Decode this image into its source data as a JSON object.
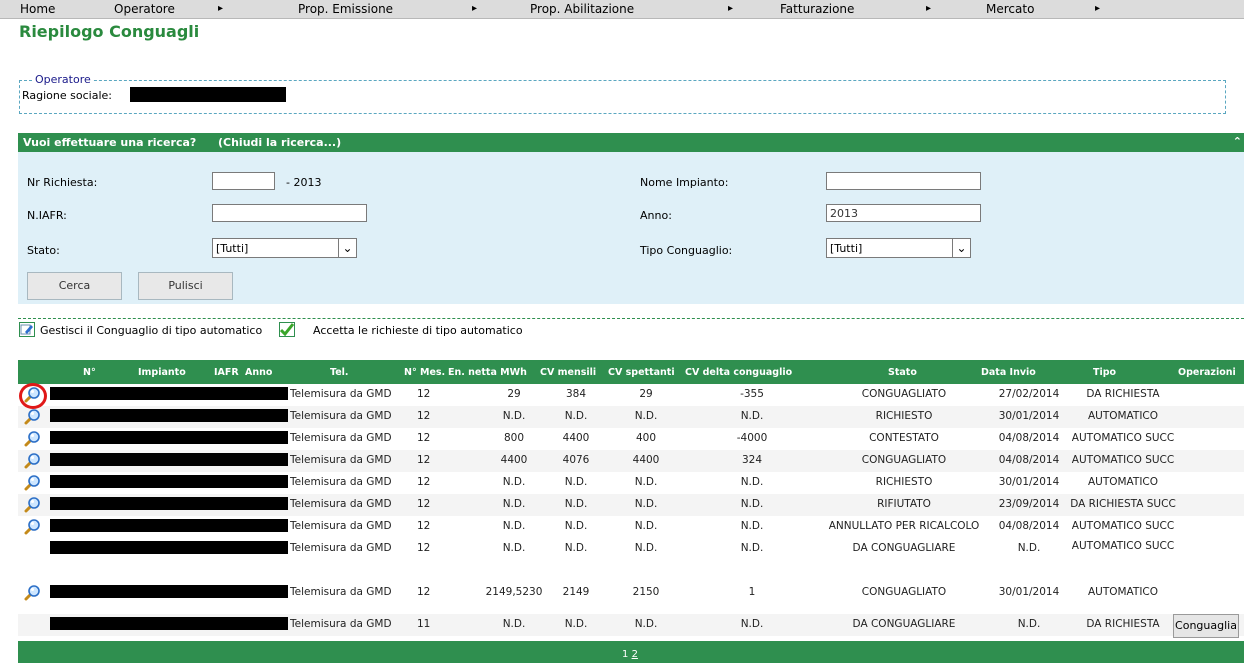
{
  "menu": {
    "items": [
      "Home",
      "Operatore",
      "Prop. Emissione",
      "Prop. Abilitazione",
      "Fatturazione",
      "Mercato"
    ],
    "arrow": "▸"
  },
  "page": {
    "title": "Riepilogo Conguagli"
  },
  "operatore": {
    "legend": "Operatore",
    "ragione_label": "Ragione sociale:"
  },
  "search": {
    "question": "Vuoi effettuare una ricerca?",
    "close_link": "(Chiudi la ricerca...)",
    "collapse_icon": "double-chevron-up-icon",
    "nr_richiesta_label": "Nr Richiesta:",
    "nr_richiesta_value": "",
    "nr_richiesta_suffix": "- 2013",
    "iafr_label": "N.IAFR:",
    "iafr_value": "",
    "stato_label": "Stato:",
    "stato_value": "[Tutti]",
    "nome_impianto_label": "Nome Impianto:",
    "nome_impianto_value": "",
    "anno_label": "Anno:",
    "anno_value": "2013",
    "tipo_conguaglio_label": "Tipo Conguaglio:",
    "tipo_conguaglio_value": "[Tutti]",
    "cerca_label": "Cerca",
    "pulisci_label": "Pulisci"
  },
  "options": {
    "gestisci_label": "Gestisci il Conguaglio di tipo automatico",
    "accetta_label": "Accetta le richieste di tipo automatico"
  },
  "table": {
    "headers": {
      "n": "N°",
      "impianto": "Impianto",
      "iafr": "IAFR",
      "anno": "Anno",
      "tel": "Tel.",
      "mes": "N° Mes.",
      "en_netta": "En. netta MWh",
      "cv_mensili": "CV mensili",
      "cv_spettanti": "CV spettanti",
      "cv_delta": "CV delta conguaglio",
      "stato": "Stato",
      "data_invio": "Data Invio",
      "tipo": "Tipo",
      "operazioni": "Operazioni"
    },
    "rows": [
      {
        "tel": "Telemisura da GMD",
        "mes": "12",
        "en": "29",
        "cvm": "384",
        "cvs": "29",
        "delta": "-355",
        "stato": "CONGUAGLIATO",
        "data": "27/02/2014",
        "tipo": "DA RICHIESTA",
        "icon": true
      },
      {
        "tel": "Telemisura da GMD",
        "mes": "12",
        "en": "N.D.",
        "cvm": "N.D.",
        "cvs": "N.D.",
        "delta": "N.D.",
        "stato": "RICHIESTO",
        "data": "30/01/2014",
        "tipo": "AUTOMATICO",
        "icon": true
      },
      {
        "tel": "Telemisura da GMD",
        "mes": "12",
        "en": "800",
        "cvm": "4400",
        "cvs": "400",
        "delta": "-4000",
        "stato": "CONTESTATO",
        "data": "04/08/2014",
        "tipo": "AUTOMATICO SUCC",
        "icon": true
      },
      {
        "tel": "Telemisura da GMD",
        "mes": "12",
        "en": "4400",
        "cvm": "4076",
        "cvs": "4400",
        "delta": "324",
        "stato": "CONGUAGLIATO",
        "data": "04/08/2014",
        "tipo": "AUTOMATICO SUCC",
        "icon": true
      },
      {
        "tel": "Telemisura da GMD",
        "mes": "12",
        "en": "N.D.",
        "cvm": "N.D.",
        "cvs": "N.D.",
        "delta": "N.D.",
        "stato": "RICHIESTO",
        "data": "30/01/2014",
        "tipo": "AUTOMATICO",
        "icon": true
      },
      {
        "tel": "Telemisura da GMD",
        "mes": "12",
        "en": "N.D.",
        "cvm": "N.D.",
        "cvs": "N.D.",
        "delta": "N.D.",
        "stato": "RIFIUTATO",
        "data": "23/09/2014",
        "tipo": "DA RICHIESTA SUCC",
        "icon": true
      },
      {
        "tel": "Telemisura da GMD",
        "mes": "12",
        "en": "N.D.",
        "cvm": "N.D.",
        "cvs": "N.D.",
        "delta": "N.D.",
        "stato": "ANNULLATO PER RICALCOLO",
        "data": "04/08/2014",
        "tipo": "AUTOMATICO SUCC",
        "icon": true
      },
      {
        "tel": "Telemisura da GMD",
        "mes": "12",
        "en": "N.D.",
        "cvm": "N.D.",
        "cvs": "N.D.",
        "delta": "N.D.",
        "stato": "DA CONGUAGLIARE",
        "data": "N.D.",
        "tipo": "AUTOMATICO SUCC",
        "icon": false
      },
      {
        "tel": "Telemisura da GMD",
        "mes": "12",
        "en": "2149,5230",
        "cvm": "2149",
        "cvs": "2150",
        "delta": "1",
        "stato": "CONGUAGLIATO",
        "data": "30/01/2014",
        "tipo": "AUTOMATICO",
        "icon": true
      },
      {
        "tel": "Telemisura da GMD",
        "mes": "11",
        "en": "N.D.",
        "cvm": "N.D.",
        "cvs": "N.D.",
        "delta": "N.D.",
        "stato": "DA CONGUAGLIARE",
        "data": "N.D.",
        "tipo": "DA RICHIESTA",
        "icon": false
      }
    ],
    "conguaglia_label": "Conguaglia",
    "pagination": {
      "page1": "1",
      "page2": "2"
    }
  },
  "colors": {
    "brand_green": "#2f8f4f",
    "title_green": "#2a8a3e",
    "panel_blue": "#dff0f8",
    "highlight_red": "#e01818"
  }
}
